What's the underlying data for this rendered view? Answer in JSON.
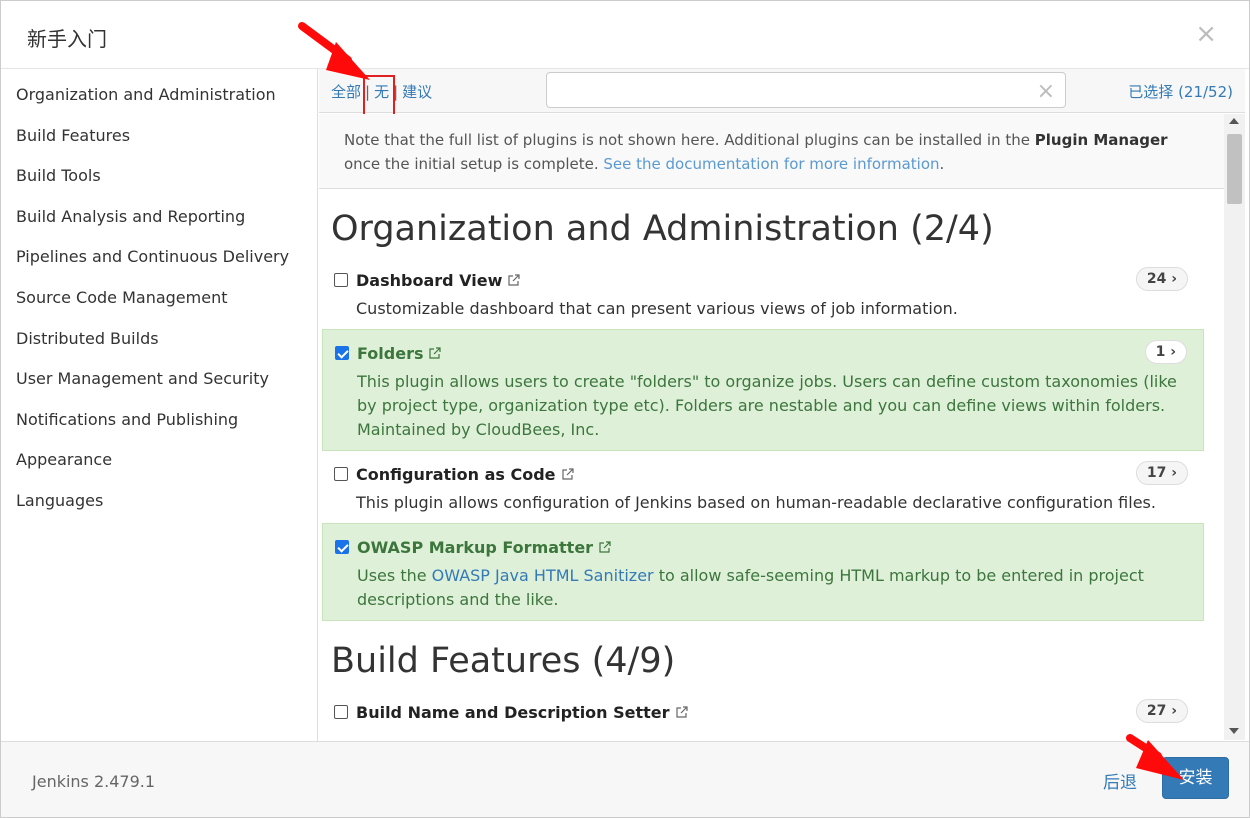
{
  "dialog": {
    "title": "新手入门",
    "close_glyph": "×"
  },
  "sidebar": {
    "items": [
      {
        "label": "Organization and Administration"
      },
      {
        "label": "Build Features"
      },
      {
        "label": "Build Tools"
      },
      {
        "label": "Build Analysis and Reporting"
      },
      {
        "label": "Pipelines and Continuous Delivery"
      },
      {
        "label": "Source Code Management"
      },
      {
        "label": "Distributed Builds"
      },
      {
        "label": "User Management and Security"
      },
      {
        "label": "Notifications and Publishing"
      },
      {
        "label": "Appearance"
      },
      {
        "label": "Languages"
      }
    ]
  },
  "toolbar": {
    "all_label": "全部",
    "none_label": "无",
    "suggested_label": "建议",
    "separator": "|",
    "search_value": "",
    "search_clear": "×",
    "selected_label": "已选择 (21/52)"
  },
  "note": {
    "text_before": "Note that the full list of plugins is not shown here. Additional plugins can be installed in the ",
    "bold": "Plugin Manager",
    "text_after": " once the initial setup is complete. ",
    "link": "See the documentation for more information",
    "period": "."
  },
  "sections": [
    {
      "title": "Organization and Administration (2/4)",
      "plugins": [
        {
          "name": "Dashboard View",
          "deps": "24",
          "checked": false,
          "desc": "Customizable dashboard that can present various views of job information."
        },
        {
          "name": "Folders",
          "deps": "1",
          "checked": true,
          "desc": "This plugin allows users to create \"folders\" to organize jobs. Users can define custom taxonomies (like by project type, organization type etc). Folders are nestable and you can define views within folders. Maintained by CloudBees, Inc."
        },
        {
          "name": "Configuration as Code",
          "deps": "17",
          "checked": false,
          "desc": "This plugin allows configuration of Jenkins based on human-readable declarative configuration files."
        },
        {
          "name": "OWASP Markup Formatter",
          "deps": "",
          "checked": true,
          "desc_before": "Uses the ",
          "desc_link": "OWASP Java HTML Sanitizer",
          "desc_after": " to allow safe-seeming HTML markup to be entered in project descriptions and the like."
        }
      ]
    },
    {
      "title": "Build Features (4/9)",
      "plugins": [
        {
          "name": "Build Name and Description Setter",
          "deps": "27",
          "checked": false
        }
      ]
    }
  ],
  "badge_chevron": "›",
  "footer": {
    "version": "Jenkins 2.479.1",
    "back_label": "后退",
    "install_label": "安装"
  },
  "colors": {
    "accent": "#337ab7",
    "selected_bg": "#dff0d8",
    "selected_text": "#3c763d",
    "annotation": "#e02020"
  }
}
